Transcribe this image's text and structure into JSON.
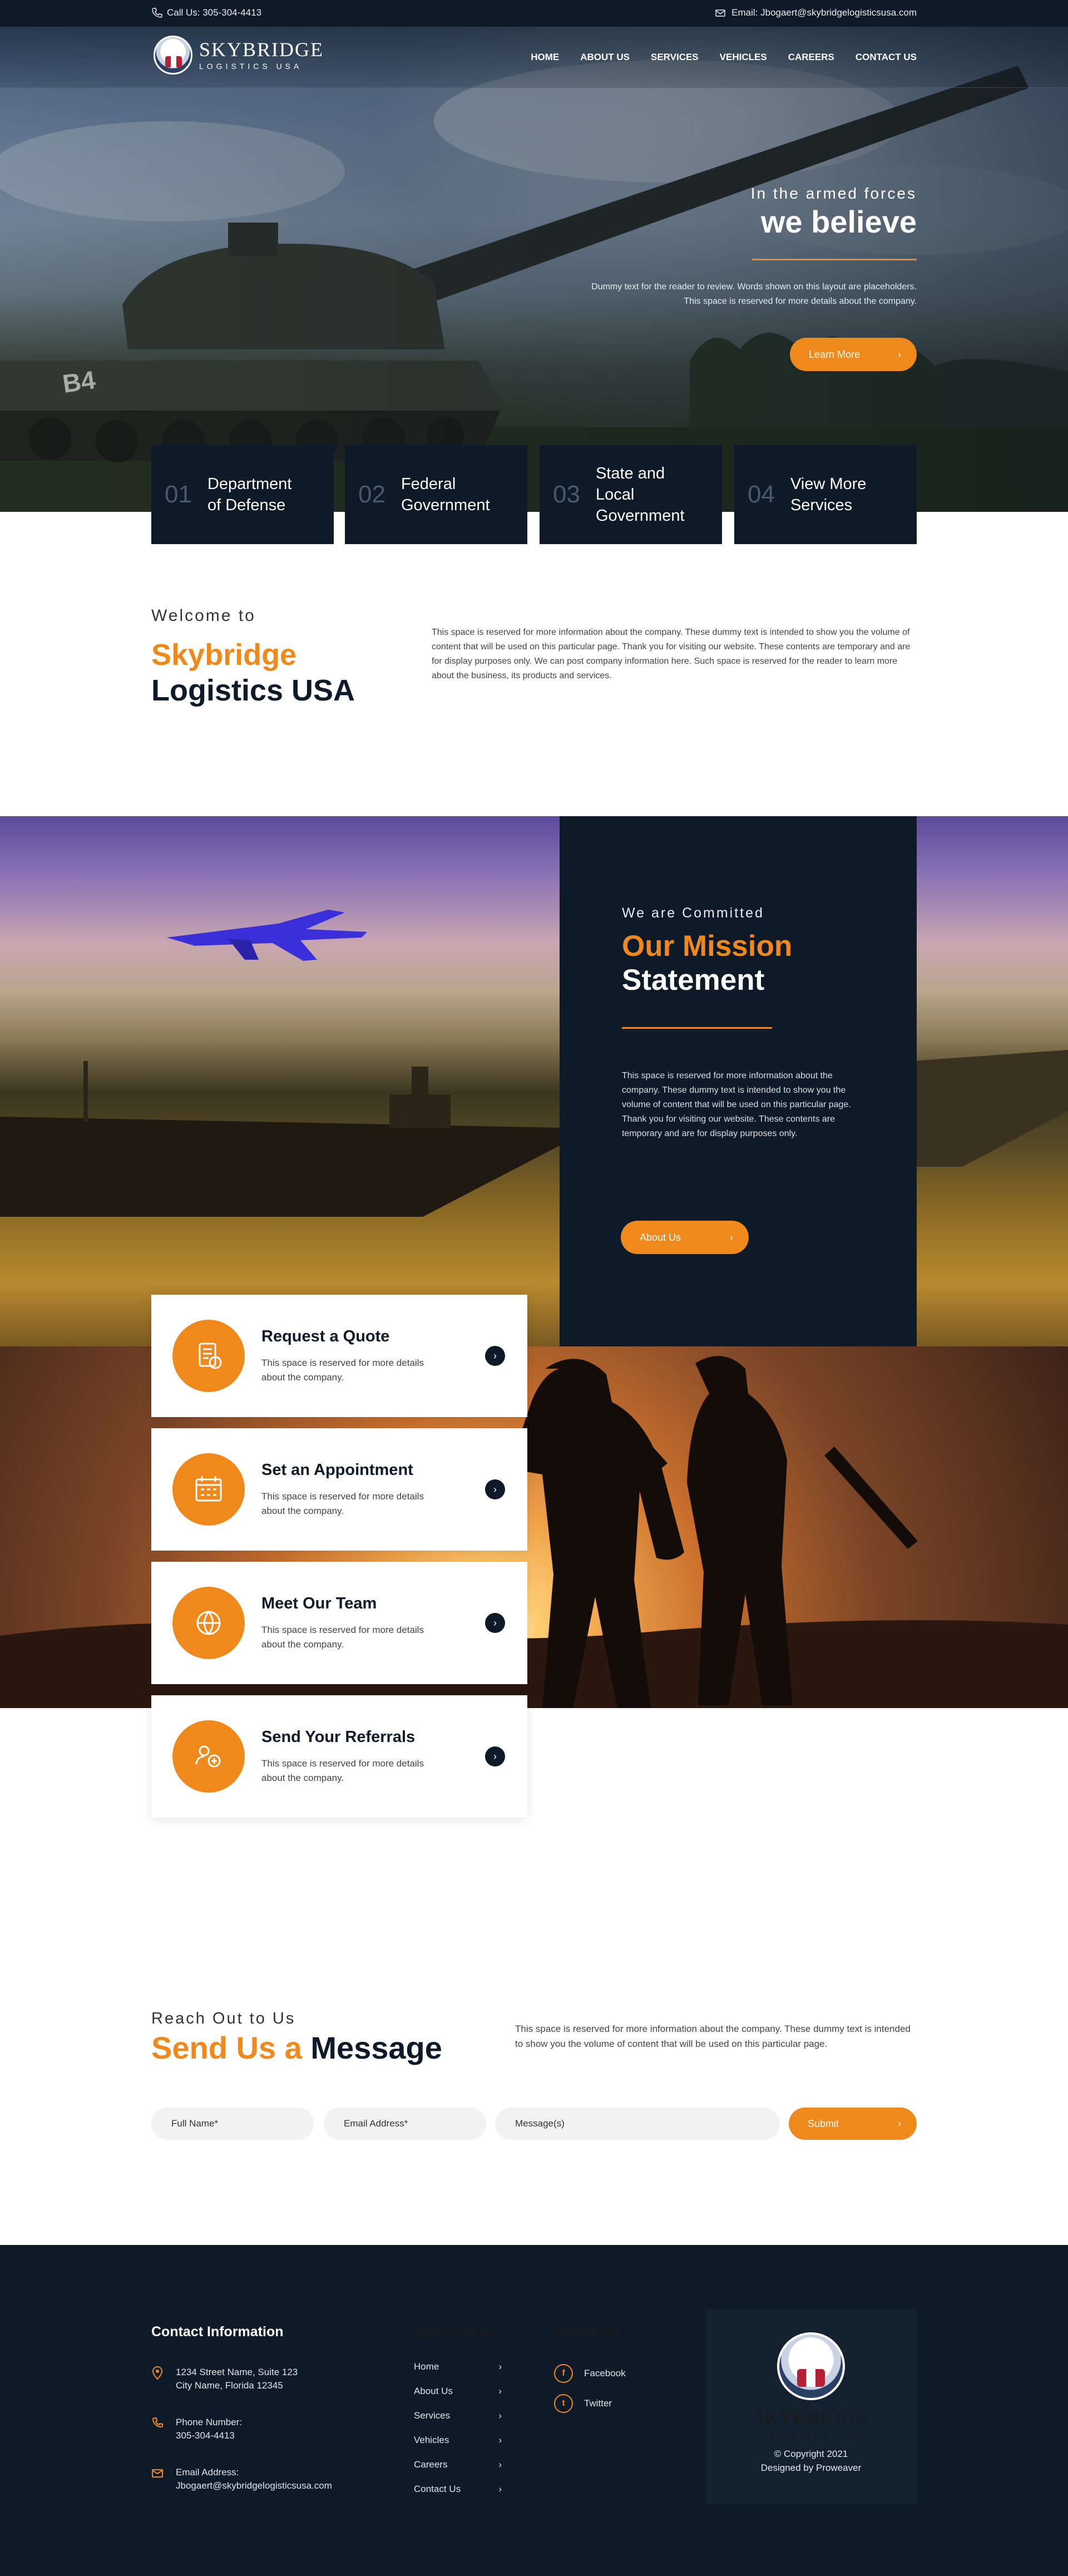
{
  "topbar": {
    "phone": "Call Us: 305-304-4413",
    "email": "Email: Jbogaert@skybridgelogisticsusa.com"
  },
  "logo": {
    "name": "SKYBRIDGE",
    "sub": "LOGISTICS USA"
  },
  "nav": {
    "items": [
      {
        "label": "HOME"
      },
      {
        "label": "ABOUT US"
      },
      {
        "label": "SERVICES"
      },
      {
        "label": "VEHICLES"
      },
      {
        "label": "CAREERS"
      },
      {
        "label": "CONTACT US"
      }
    ]
  },
  "hero": {
    "pre": "In the armed forces",
    "title": "we believe",
    "desc": "Dummy text for the reader to review. Words shown on this layout are placeholders. This space is reserved for more details about the company.",
    "button": "Learn More",
    "arrow": "›"
  },
  "services": [
    {
      "num": "01",
      "label": "Department of Defense"
    },
    {
      "num": "02",
      "label": "Federal Government"
    },
    {
      "num": "03",
      "label": "State and Local Government"
    },
    {
      "num": "04",
      "label": "View More Services"
    }
  ],
  "welcome": {
    "pre": "Welcome to",
    "title_orange": "Skybridge",
    "title_navy": "Logistics USA",
    "desc": "This space is reserved for more information about the company. These dummy text is intended to show you the volume of content that will be used on this particular page.  Thank you for visiting our website. These contents are temporary and are for display purposes only.  We can post company information here. Such space is reserved for the reader to learn more about the business, its products and services."
  },
  "mission": {
    "pre": "We are Committed",
    "title_orange": "Our Mission",
    "title_white": "Statement",
    "desc": "This space is reserved for more information about the company. These dummy text is intended to show you the volume of content that will be used on this particular page.  Thank you for visiting our website. These contents are temporary and are for display purposes only.",
    "button": "About Us",
    "arrow": "›"
  },
  "cards": [
    {
      "title": "Request a Quote",
      "desc": "This space is reserved for more details about the company.",
      "icon": "quote-icon",
      "arrow": "›"
    },
    {
      "title": "Set an Appointment",
      "desc": "This space is reserved for more details about the company.",
      "icon": "calendar-icon",
      "arrow": "›"
    },
    {
      "title": "Meet Our Team",
      "desc": "This space is reserved for more details about the company.",
      "icon": "team-icon",
      "arrow": "›"
    },
    {
      "title": "Send Your Referrals",
      "desc": "This space is reserved for more details about the company.",
      "icon": "referral-icon",
      "arrow": "›"
    }
  ],
  "contact": {
    "pre": "Reach Out to Us",
    "title_orange": "Send Us a",
    "title_navy": "Message",
    "desc": "This space is reserved for more information about the company. These dummy text is intended to show you the volume of content that will be used on this particular page.",
    "full_name_placeholder": "Full Name*",
    "email_placeholder": "Email Address*",
    "message_placeholder": "Message(s)",
    "submit": "Submit",
    "arrow": "›"
  },
  "footer": {
    "contact_heading": "Contact Information",
    "address_line1": "1234 Street Name, Suite 123",
    "address_line2": "City Name, Florida 12345",
    "phone_label": "Phone Number:",
    "phone": "305-304-4413",
    "email_label": "Email Address:",
    "email": "Jbogaert@skybridgelogisticsusa.com",
    "links_heading": "Quick Links",
    "links": [
      "Home",
      "About Us",
      "Services",
      "Vehicles",
      "Careers",
      "Contact Us"
    ],
    "link_arrow": "›",
    "follow_heading": "Follow Us",
    "social": [
      {
        "label": "Facebook",
        "glyph": "f"
      },
      {
        "label": "Twitter",
        "glyph": "t"
      }
    ],
    "logo_name": "SKYBRIDGE",
    "logo_sub": "LOGISTICS USA",
    "copyright": "© Copyright 2021",
    "designed": "Designed by Proweaver"
  },
  "colors": {
    "navy": "#0e1a27",
    "orange": "#f0891c",
    "white": "#ffffff"
  }
}
